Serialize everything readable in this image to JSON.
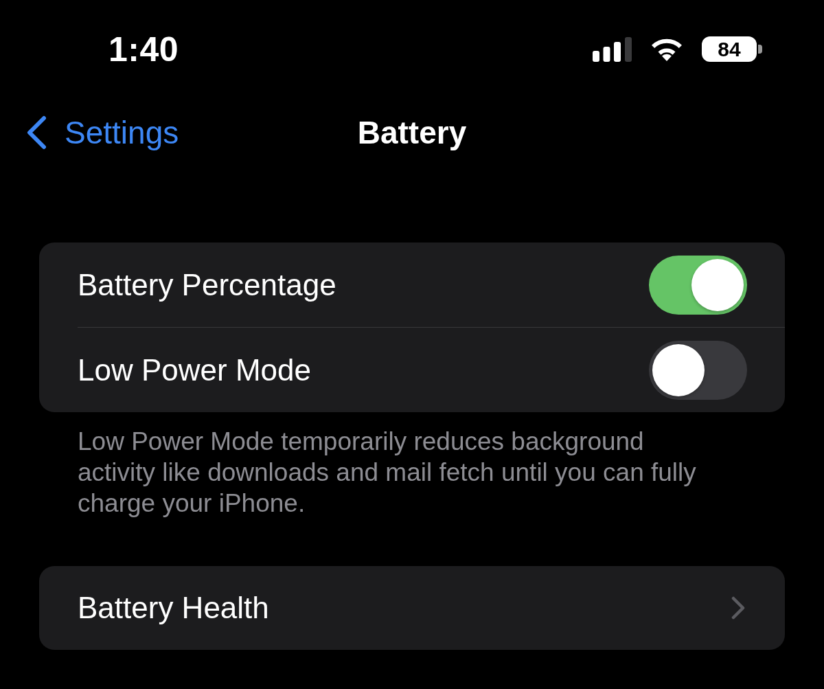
{
  "status_bar": {
    "time": "1:40",
    "battery_percent": "84"
  },
  "nav_bar": {
    "back_label": "Settings",
    "title": "Battery"
  },
  "groups": [
    {
      "rows": [
        {
          "kind": "toggle",
          "label": "Battery Percentage",
          "on": true
        },
        {
          "kind": "toggle",
          "label": "Low Power Mode",
          "on": false
        }
      ],
      "footer": "Low Power Mode temporarily reduces background activity like downloads and mail fetch until you can fully charge your iPhone."
    },
    {
      "rows": [
        {
          "kind": "link",
          "label": "Battery Health"
        }
      ]
    }
  ]
}
